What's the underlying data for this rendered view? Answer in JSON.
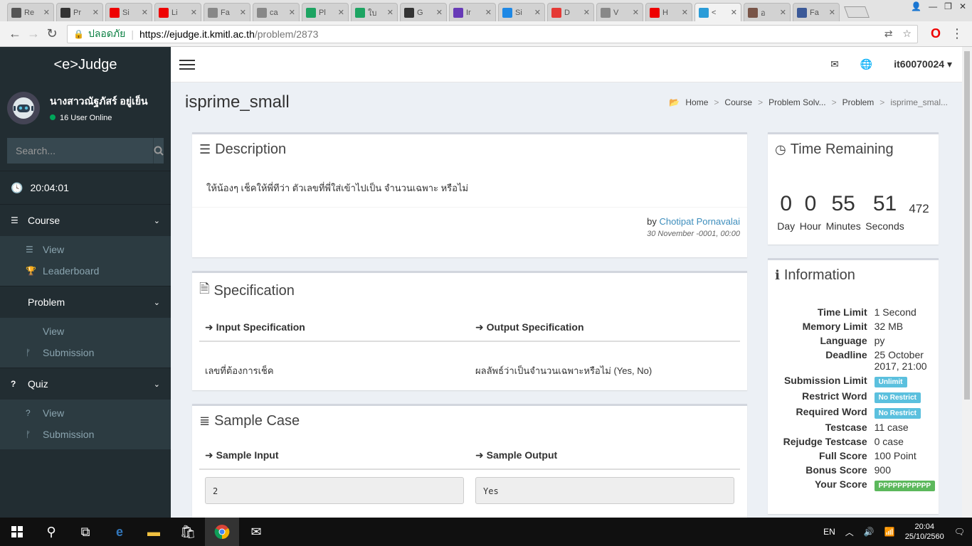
{
  "browser": {
    "tabs": [
      {
        "title": "Re",
        "color": "#555"
      },
      {
        "title": "Pr",
        "color": "#333"
      },
      {
        "title": "Si",
        "color": "#e00"
      },
      {
        "title": "Li",
        "color": "#e00"
      },
      {
        "title": "Fa",
        "color": "#888"
      },
      {
        "title": "ca",
        "color": "#888"
      },
      {
        "title": "Pl",
        "color": "#1da462"
      },
      {
        "title": "ใบ",
        "color": "#1da462"
      },
      {
        "title": "G",
        "color": "#333"
      },
      {
        "title": "Ir",
        "color": "#673ab7"
      },
      {
        "title": "Si",
        "color": "#1e88e5"
      },
      {
        "title": "D",
        "color": "#e53935"
      },
      {
        "title": "V",
        "color": "#888"
      },
      {
        "title": "H",
        "color": "#e00"
      },
      {
        "title": "<",
        "color": "#2b9cd8"
      },
      {
        "title": "อ",
        "color": "#795548"
      },
      {
        "title": "Fa",
        "color": "#3b5998"
      }
    ],
    "secure_label": "ปลอดภัย",
    "url_host": "https://ejudge.it.kmitl.ac.th",
    "url_path": "/problem/2873"
  },
  "sidebar": {
    "brand": "<e>Judge",
    "user_name": "นางสาวณัฐภัสร์ อยู่เย็น",
    "online": "16 User Online",
    "search_placeholder": "Search...",
    "clock": "20:04:01",
    "sections": [
      {
        "label": "Course",
        "items": [
          "View",
          "Leaderboard"
        ]
      },
      {
        "label": "Problem",
        "items": [
          "View",
          "Submission"
        ]
      },
      {
        "label": "Quiz",
        "items": [
          "View",
          "Submission"
        ]
      }
    ]
  },
  "topbar": {
    "username": "it60070024"
  },
  "page": {
    "title": "isprime_small",
    "breadcrumb": [
      "Home",
      "Course",
      "Problem Solv...",
      "Problem",
      "isprime_smal..."
    ]
  },
  "description": {
    "heading": "Description",
    "text": "ให้น้องๆ เช็คให้พี่ทีว่า ตัวเลขที่พี่ใส่เข้าไปเป็น จำนวนเฉพาะ หรือไม่",
    "by_label": "by",
    "author": "Chotipat Pornavalai",
    "date": "30 November -0001, 00:00"
  },
  "specification": {
    "heading": "Specification",
    "input_heading": "Input Specification",
    "output_heading": "Output Specification",
    "input_text": "เลขที่ต้องการเช็ค",
    "output_text": "ผลลัพธ์ว่าเป็นจำนวนเฉพาะหรือไม่ (Yes, No)"
  },
  "sample": {
    "heading": "Sample Case",
    "input_heading": "Sample Input",
    "output_heading": "Sample Output",
    "input": "2",
    "output": "Yes"
  },
  "timer": {
    "heading": "Time Remaining",
    "day": "0",
    "hour": "0",
    "minutes": "55",
    "seconds": "51",
    "ms": "472",
    "day_label": "Day",
    "hour_label": "Hour",
    "minutes_label": "Minutes",
    "seconds_label": "Seconds"
  },
  "info": {
    "heading": "Information",
    "rows": [
      {
        "k": "Time Limit",
        "v": "1 Second"
      },
      {
        "k": "Memory Limit",
        "v": "32 MB"
      },
      {
        "k": "Language",
        "v": "py"
      },
      {
        "k": "Deadline",
        "v": "25 October 2017, 21:00"
      },
      {
        "k": "Submission Limit",
        "v": "Unlimit",
        "badge": "blue"
      },
      {
        "k": "Restrict Word",
        "v": "No Restrict",
        "badge": "blue"
      },
      {
        "k": "Required Word",
        "v": "No Restrict",
        "badge": "blue"
      },
      {
        "k": "Testcase",
        "v": "11 case"
      },
      {
        "k": "Rejudge Testcase",
        "v": "0 case"
      },
      {
        "k": "Full Score",
        "v": "100 Point"
      },
      {
        "k": "Bonus Score",
        "v": "900"
      },
      {
        "k": "Your Score",
        "v": "PPPPPPPPPPP",
        "badge": "green"
      }
    ]
  },
  "taskbar": {
    "lang": "EN",
    "time": "20:04",
    "date": "25/10/2560"
  }
}
